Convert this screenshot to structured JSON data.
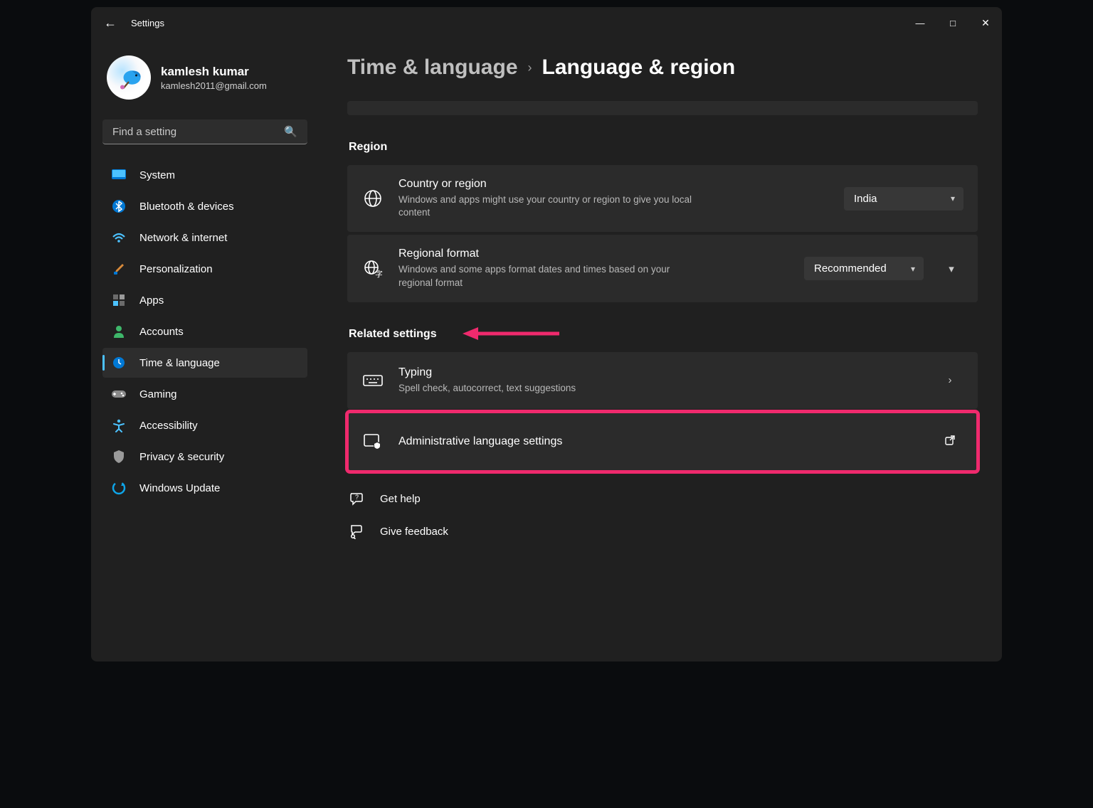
{
  "app": {
    "title": "Settings"
  },
  "user": {
    "name": "kamlesh kumar",
    "email": "kamlesh2011@gmail.com"
  },
  "search": {
    "placeholder": "Find a setting"
  },
  "nav": {
    "system": "System",
    "bluetooth": "Bluetooth & devices",
    "network": "Network & internet",
    "personalization": "Personalization",
    "apps": "Apps",
    "accounts": "Accounts",
    "time": "Time & language",
    "gaming": "Gaming",
    "accessibility": "Accessibility",
    "privacy": "Privacy & security",
    "update": "Windows Update"
  },
  "breadcrumb": {
    "parent": "Time & language",
    "current": "Language & region"
  },
  "sections": {
    "region": "Region",
    "related": "Related settings"
  },
  "region": {
    "country": {
      "title": "Country or region",
      "sub": "Windows and apps might use your country or region to give you local content",
      "value": "India"
    },
    "format": {
      "title": "Regional format",
      "sub": "Windows and some apps format dates and times based on your regional format",
      "value": "Recommended"
    }
  },
  "related": {
    "typing": {
      "title": "Typing",
      "sub": "Spell check, autocorrect, text suggestions"
    },
    "admin": {
      "title": "Administrative language settings"
    }
  },
  "footer": {
    "help": "Get help",
    "feedback": "Give feedback"
  }
}
